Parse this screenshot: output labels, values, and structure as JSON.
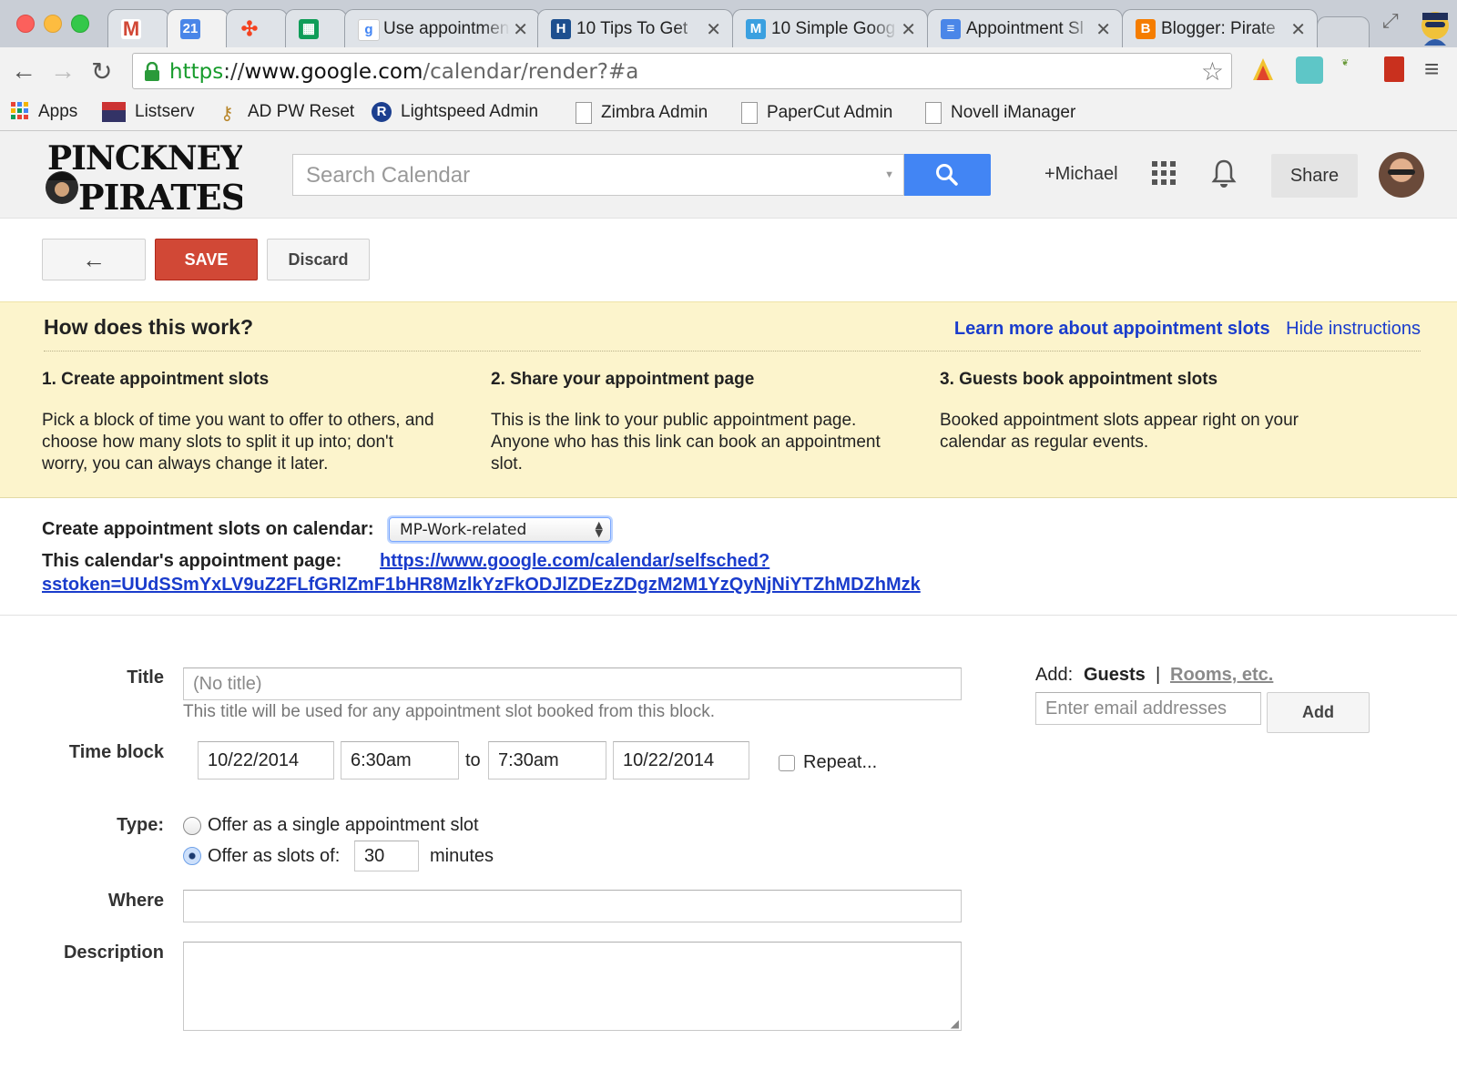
{
  "browser": {
    "tabs": [
      {
        "title": "",
        "favicon": "gmail-icon"
      },
      {
        "title": "",
        "favicon": "calendar-icon",
        "favicon_text": "21",
        "active": true
      },
      {
        "title": "",
        "favicon": "joomla-icon"
      },
      {
        "title": "",
        "favicon": "sheets-icon"
      },
      {
        "title": "Use appointmen",
        "favicon": "google-icon"
      },
      {
        "title": "10 Tips To Get",
        "favicon": "h-icon"
      },
      {
        "title": "10 Simple Goog",
        "favicon": "m-icon"
      },
      {
        "title": "Appointment Sl",
        "favicon": "docs-icon"
      },
      {
        "title": "Blogger: Pirate",
        "favicon": "blogger-icon"
      }
    ],
    "url": {
      "scheme": "https",
      "separator": "://",
      "host": "www.google.com",
      "path": "/calendar/render?#a"
    },
    "bookmarks": [
      {
        "label": "Apps",
        "icon": "apps-grid-icon"
      },
      {
        "label": "Listserv",
        "icon": "mailman-icon"
      },
      {
        "label": "AD PW Reset",
        "icon": "key-icon"
      },
      {
        "label": "Lightspeed Admin",
        "icon": "lightspeed-icon"
      },
      {
        "label": "Zimbra Admin",
        "icon": "page-icon"
      },
      {
        "label": "PaperCut Admin",
        "icon": "page-icon"
      },
      {
        "label": "Novell iManager",
        "icon": "page-icon"
      }
    ]
  },
  "header": {
    "logo_text": [
      "PINCKNEY",
      "PIRATES"
    ],
    "search_placeholder": "Search Calendar",
    "user": "+Michael",
    "share_label": "Share"
  },
  "actions": {
    "back_label": "←",
    "save_label": "SAVE",
    "discard_label": "Discard"
  },
  "info": {
    "heading": "How does this work?",
    "learn_more": "Learn more about appointment slots",
    "hide": "Hide instructions",
    "steps": [
      {
        "title": "1. Create appointment slots",
        "body": "Pick a block of time you want to offer to others, and choose how many slots to split it up into; don't worry, you can always change it later."
      },
      {
        "title": "2. Share your appointment page",
        "body": "This is the link to your public appointment page. Anyone who has this link can book an appointment slot."
      },
      {
        "title": "3. Guests book appointment slots",
        "body": "Booked appointment slots appear right on your calendar as regular events."
      }
    ]
  },
  "calendar": {
    "create_label": "Create appointment slots on calendar:",
    "selected": "MP-Work-related",
    "page_label": "This calendar's appointment page:",
    "page_url_line1": "https://www.google.com/calendar/selfsched?",
    "page_url_line2": "sstoken=UUdSSmYxLV9uZ2FLfGRlZmF1bHR8MzlkYzFkODJlZDEzZDgzM2M1YzQyNjNiYTZhMDZhMzk"
  },
  "form": {
    "title_label": "Title",
    "title_placeholder": "(No title)",
    "title_hint": "This title will be used for any appointment slot booked from this block.",
    "time_label": "Time block",
    "start_date": "10/22/2014",
    "start_time": "6:30am",
    "to_label": "to",
    "end_time": "7:30am",
    "end_date": "10/22/2014",
    "repeat_label": "Repeat...",
    "type_label": "Type:",
    "type_single": "Offer as a single appointment slot",
    "type_slots": "Offer as slots of:",
    "slot_minutes": "30",
    "minutes_label": "minutes",
    "where_label": "Where",
    "description_label": "Description"
  },
  "guests": {
    "add_label": "Add:",
    "guests_tab": "Guests",
    "separator": "|",
    "rooms_tab": "Rooms, etc.",
    "email_placeholder": "Enter email addresses",
    "add_button": "Add"
  },
  "colors": {
    "save": "#d14836",
    "search_button": "#4285f4",
    "info_background": "#fcf4cc",
    "link": "#1a3ccc"
  }
}
